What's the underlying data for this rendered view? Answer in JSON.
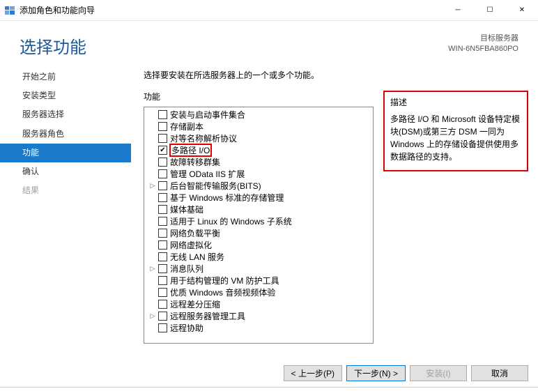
{
  "window": {
    "title": "添加角色和功能向导"
  },
  "header": {
    "page_title": "选择功能",
    "target_label": "目标服务器",
    "target_value": "WIN-6N5FBA860PO"
  },
  "sidebar": {
    "items": [
      {
        "label": "开始之前",
        "state": "normal"
      },
      {
        "label": "安装类型",
        "state": "normal"
      },
      {
        "label": "服务器选择",
        "state": "normal"
      },
      {
        "label": "服务器角色",
        "state": "normal"
      },
      {
        "label": "功能",
        "state": "active"
      },
      {
        "label": "确认",
        "state": "normal"
      },
      {
        "label": "结果",
        "state": "disabled"
      }
    ]
  },
  "main": {
    "instruction": "选择要安装在所选服务器上的一个或多个功能。",
    "features_label": "功能",
    "description_label": "描述",
    "description_text": "多路径 I/O 和 Microsoft 设备特定模块(DSM)或第三方 DSM 一同为 Windows 上的存储设备提供使用多数据路径的支持。",
    "features": [
      {
        "label": "安装与启动事件集合",
        "checked": false,
        "expandable": false
      },
      {
        "label": "存储副本",
        "checked": false,
        "expandable": false
      },
      {
        "label": "对等名称解析协议",
        "checked": false,
        "expandable": false
      },
      {
        "label": "多路径 I/O",
        "checked": true,
        "expandable": false,
        "highlight": true
      },
      {
        "label": "故障转移群集",
        "checked": false,
        "expandable": false
      },
      {
        "label": "管理 OData IIS 扩展",
        "checked": false,
        "expandable": false
      },
      {
        "label": "后台智能传输服务(BITS)",
        "checked": false,
        "expandable": true
      },
      {
        "label": "基于 Windows 标准的存储管理",
        "checked": false,
        "expandable": false
      },
      {
        "label": "媒体基础",
        "checked": false,
        "expandable": false
      },
      {
        "label": "适用于 Linux 的 Windows 子系统",
        "checked": false,
        "expandable": false
      },
      {
        "label": "网络负载平衡",
        "checked": false,
        "expandable": false
      },
      {
        "label": "网络虚拟化",
        "checked": false,
        "expandable": false
      },
      {
        "label": "无线 LAN 服务",
        "checked": false,
        "expandable": false
      },
      {
        "label": "消息队列",
        "checked": false,
        "expandable": true
      },
      {
        "label": "用于结构管理的 VM 防护工具",
        "checked": false,
        "expandable": false
      },
      {
        "label": "优质 Windows 音频视频体验",
        "checked": false,
        "expandable": false
      },
      {
        "label": "远程差分压缩",
        "checked": false,
        "expandable": false
      },
      {
        "label": "远程服务器管理工具",
        "checked": false,
        "expandable": true
      },
      {
        "label": "远程协助",
        "checked": false,
        "expandable": false
      }
    ]
  },
  "footer": {
    "prev": "< 上一步(P)",
    "next": "下一步(N) >",
    "install": "安装(I)",
    "cancel": "取消"
  }
}
